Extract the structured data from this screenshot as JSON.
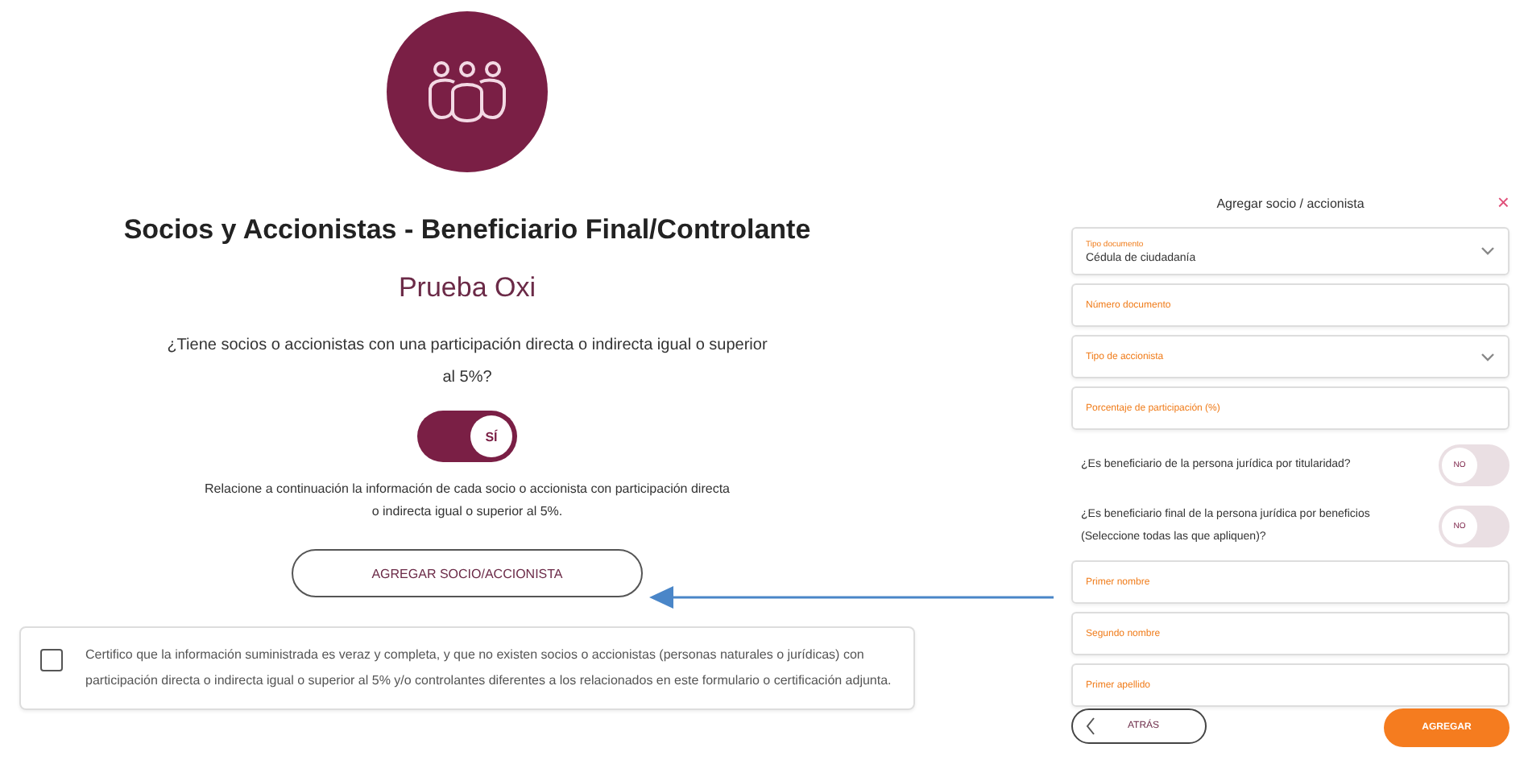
{
  "main": {
    "title": "Socios y Accionistas - Beneficiario Final/Controlante",
    "company": "Prueba Oxi",
    "question": "¿Tiene socios o accionistas con una participación directa o indirecta igual o superior al 5%?",
    "has_partners": {
      "label": "SÍ",
      "on": true
    },
    "instructions": "Relacione a continuación la información de cada socio o accionista con participación directa o indirecta igual o superior al 5%.",
    "add_button": "AGREGAR SOCIO/ACCIONISTA",
    "certification": {
      "checked": false,
      "text": "Certifico que la información suministrada es veraz y completa, y que no existen socios o accionistas (personas naturales o jurídicas) con participación directa o indirecta igual o superior al 5% y/o controlantes diferentes a los relacionados en este formulario o certificación adjunta."
    }
  },
  "dialog": {
    "title": "Agregar socio / accionista",
    "close": "×",
    "items": [
      {
        "kind": "select",
        "label": "Tipo documento",
        "value": "Cédula de ciudadanía"
      },
      {
        "kind": "text",
        "label": "Número documento"
      },
      {
        "kind": "select",
        "label": "Tipo de accionista"
      },
      {
        "kind": "text",
        "label": "Porcentaje de participación (%)"
      },
      {
        "kind": "toggle",
        "label": "¿Es beneficiario de la persona jurídica por titularidad?",
        "state": "NO",
        "on": false
      },
      {
        "kind": "toggle",
        "label": "¿Es beneficiario final de la persona jurídica por beneficios (Seleccione todas las que apliquen)?",
        "state": "NO",
        "on": false
      },
      {
        "kind": "text",
        "label": "Primer nombre"
      },
      {
        "kind": "text",
        "label": "Segundo nombre"
      },
      {
        "kind": "text",
        "label": "Primer apellido"
      }
    ],
    "back_button": "ATRÁS",
    "submit_button": "AGREGAR"
  }
}
